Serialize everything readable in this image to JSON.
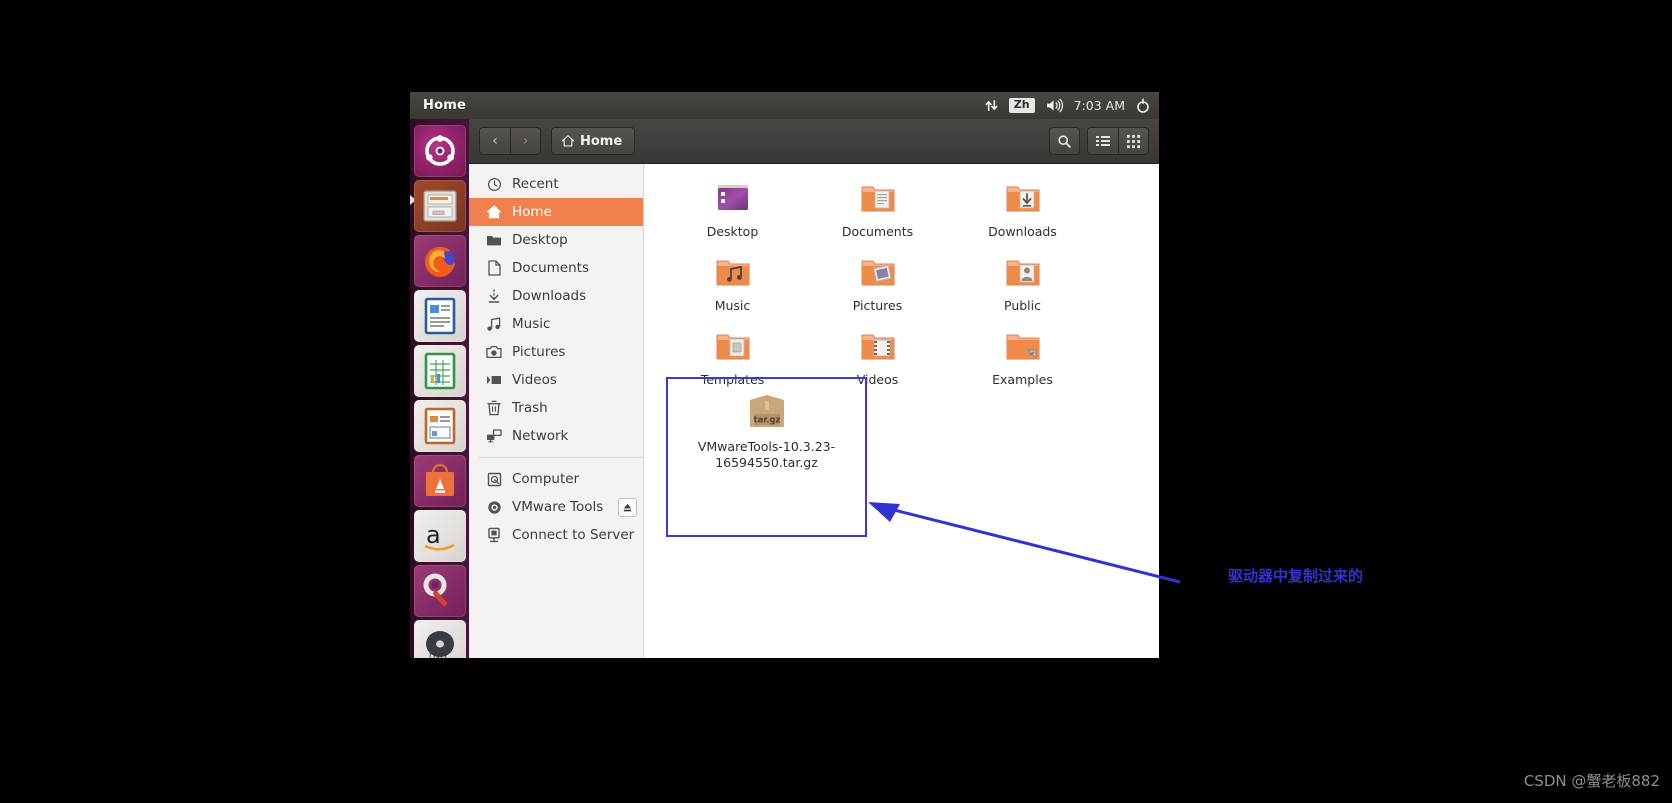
{
  "panel": {
    "title": "Home",
    "clock": "7:03 AM",
    "language_badge": "Zh",
    "icons": {
      "network": "network-updown-icon",
      "language": "language-indicator",
      "volume": "volume-icon",
      "gear": "gear-icon"
    }
  },
  "launcher": {
    "items": [
      {
        "name": "ubuntu-dash",
        "label": "Ubuntu Dash"
      },
      {
        "name": "files-nautilus",
        "label": "Files"
      },
      {
        "name": "firefox",
        "label": "Firefox"
      },
      {
        "name": "libreoffice-writer",
        "label": "LibreOffice Writer"
      },
      {
        "name": "libreoffice-calc",
        "label": "LibreOffice Calc"
      },
      {
        "name": "libreoffice-impress",
        "label": "LibreOffice Impress"
      },
      {
        "name": "ubuntu-software",
        "label": "Ubuntu Software"
      },
      {
        "name": "amazon",
        "label": "Amazon"
      },
      {
        "name": "system-settings",
        "label": "System Settings"
      },
      {
        "name": "dvd-drive",
        "label": "DVD"
      }
    ]
  },
  "toolbar": {
    "back_label": "‹",
    "forward_label": "›",
    "path_label": "Home",
    "search_label": "search-icon",
    "list_view_label": "list-view-icon",
    "grid_view_label": "grid-view-icon"
  },
  "sidebar": {
    "items": [
      {
        "label": "Recent",
        "icon": "clock-icon",
        "active": false
      },
      {
        "label": "Home",
        "icon": "home-icon",
        "active": true
      },
      {
        "label": "Desktop",
        "icon": "folder-icon",
        "active": false
      },
      {
        "label": "Documents",
        "icon": "document-icon",
        "active": false
      },
      {
        "label": "Downloads",
        "icon": "download-icon",
        "active": false
      },
      {
        "label": "Music",
        "icon": "music-note-icon",
        "active": false
      },
      {
        "label": "Pictures",
        "icon": "camera-icon",
        "active": false
      },
      {
        "label": "Videos",
        "icon": "video-icon",
        "active": false
      },
      {
        "label": "Trash",
        "icon": "trash-icon",
        "active": false
      },
      {
        "label": "Network",
        "icon": "network-icon",
        "active": false
      }
    ],
    "devices": [
      {
        "label": "Computer",
        "icon": "computer-disk-icon",
        "eject": false
      },
      {
        "label": "VMware Tools",
        "icon": "optical-disc-icon",
        "eject": true
      },
      {
        "label": "Connect to Server",
        "icon": "server-icon",
        "eject": false
      }
    ]
  },
  "files": [
    {
      "name": "Desktop",
      "type": "folder-desktop"
    },
    {
      "name": "Documents",
      "type": "folder-documents"
    },
    {
      "name": "Downloads",
      "type": "folder-downloads"
    },
    {
      "name": "Music",
      "type": "folder-music"
    },
    {
      "name": "Pictures",
      "type": "folder-pictures"
    },
    {
      "name": "Public",
      "type": "folder-public"
    },
    {
      "name": "Templates",
      "type": "folder-templates"
    },
    {
      "name": "Videos",
      "type": "folder-videos"
    },
    {
      "name": "Examples",
      "type": "folder-examples"
    }
  ],
  "selected_file": {
    "name": "VMwareTools-10.3.23-16594550.tar.gz",
    "type": "archive",
    "icon_label": "tar.gz"
  },
  "annotation": {
    "text": "驱动器中复制过来的",
    "color": "#3232d2"
  },
  "watermark": {
    "text": "CSDN @蟹老板882"
  }
}
